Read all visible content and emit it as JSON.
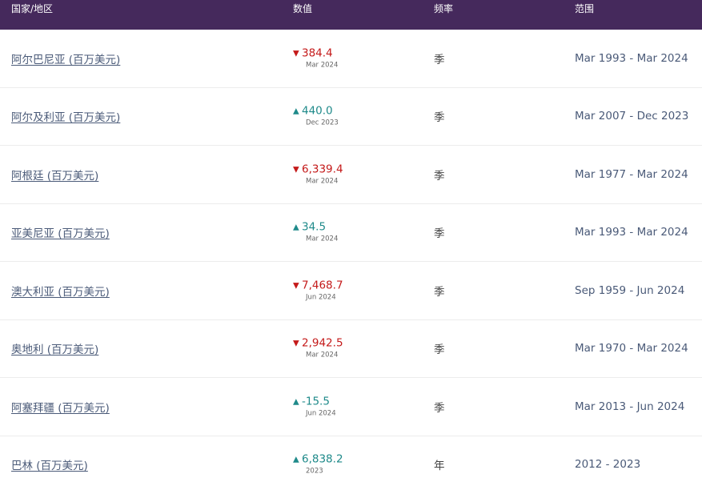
{
  "header": {
    "country": "国家/地区",
    "value": "数值",
    "frequency": "频率",
    "range": "范围"
  },
  "rows": [
    {
      "name": "阿尔巴尼亚 (百万美元)",
      "direction": "down",
      "value": "384.4",
      "date": "Mar 2024",
      "frequency": "季",
      "range": "Mar 1993 - Mar 2024"
    },
    {
      "name": "阿尔及利亚 (百万美元)",
      "direction": "up",
      "value": "440.0",
      "date": "Dec 2023",
      "frequency": "季",
      "range": "Mar 2007 - Dec 2023"
    },
    {
      "name": "阿根廷 (百万美元)",
      "direction": "down",
      "value": "6,339.4",
      "date": "Mar 2024",
      "frequency": "季",
      "range": "Mar 1977 - Mar 2024"
    },
    {
      "name": "亚美尼亚 (百万美元)",
      "direction": "up",
      "value": "34.5",
      "date": "Mar 2024",
      "frequency": "季",
      "range": "Mar 1993 - Mar 2024"
    },
    {
      "name": "澳大利亚 (百万美元)",
      "direction": "down",
      "value": "7,468.7",
      "date": "Jun 2024",
      "frequency": "季",
      "range": "Sep 1959 - Jun 2024"
    },
    {
      "name": "奥地利 (百万美元)",
      "direction": "down",
      "value": "2,942.5",
      "date": "Mar 2024",
      "frequency": "季",
      "range": "Mar 1970 - Mar 2024"
    },
    {
      "name": "阿塞拜疆 (百万美元)",
      "direction": "up",
      "value": "-15.5",
      "date": "Jun 2024",
      "frequency": "季",
      "range": "Mar 2013 - Jun 2024"
    },
    {
      "name": "巴林 (百万美元)",
      "direction": "up",
      "value": "6,838.2",
      "date": "2023",
      "frequency": "年",
      "range": "2012 - 2023"
    }
  ],
  "arrows": {
    "down": "▼",
    "up": "▲"
  }
}
